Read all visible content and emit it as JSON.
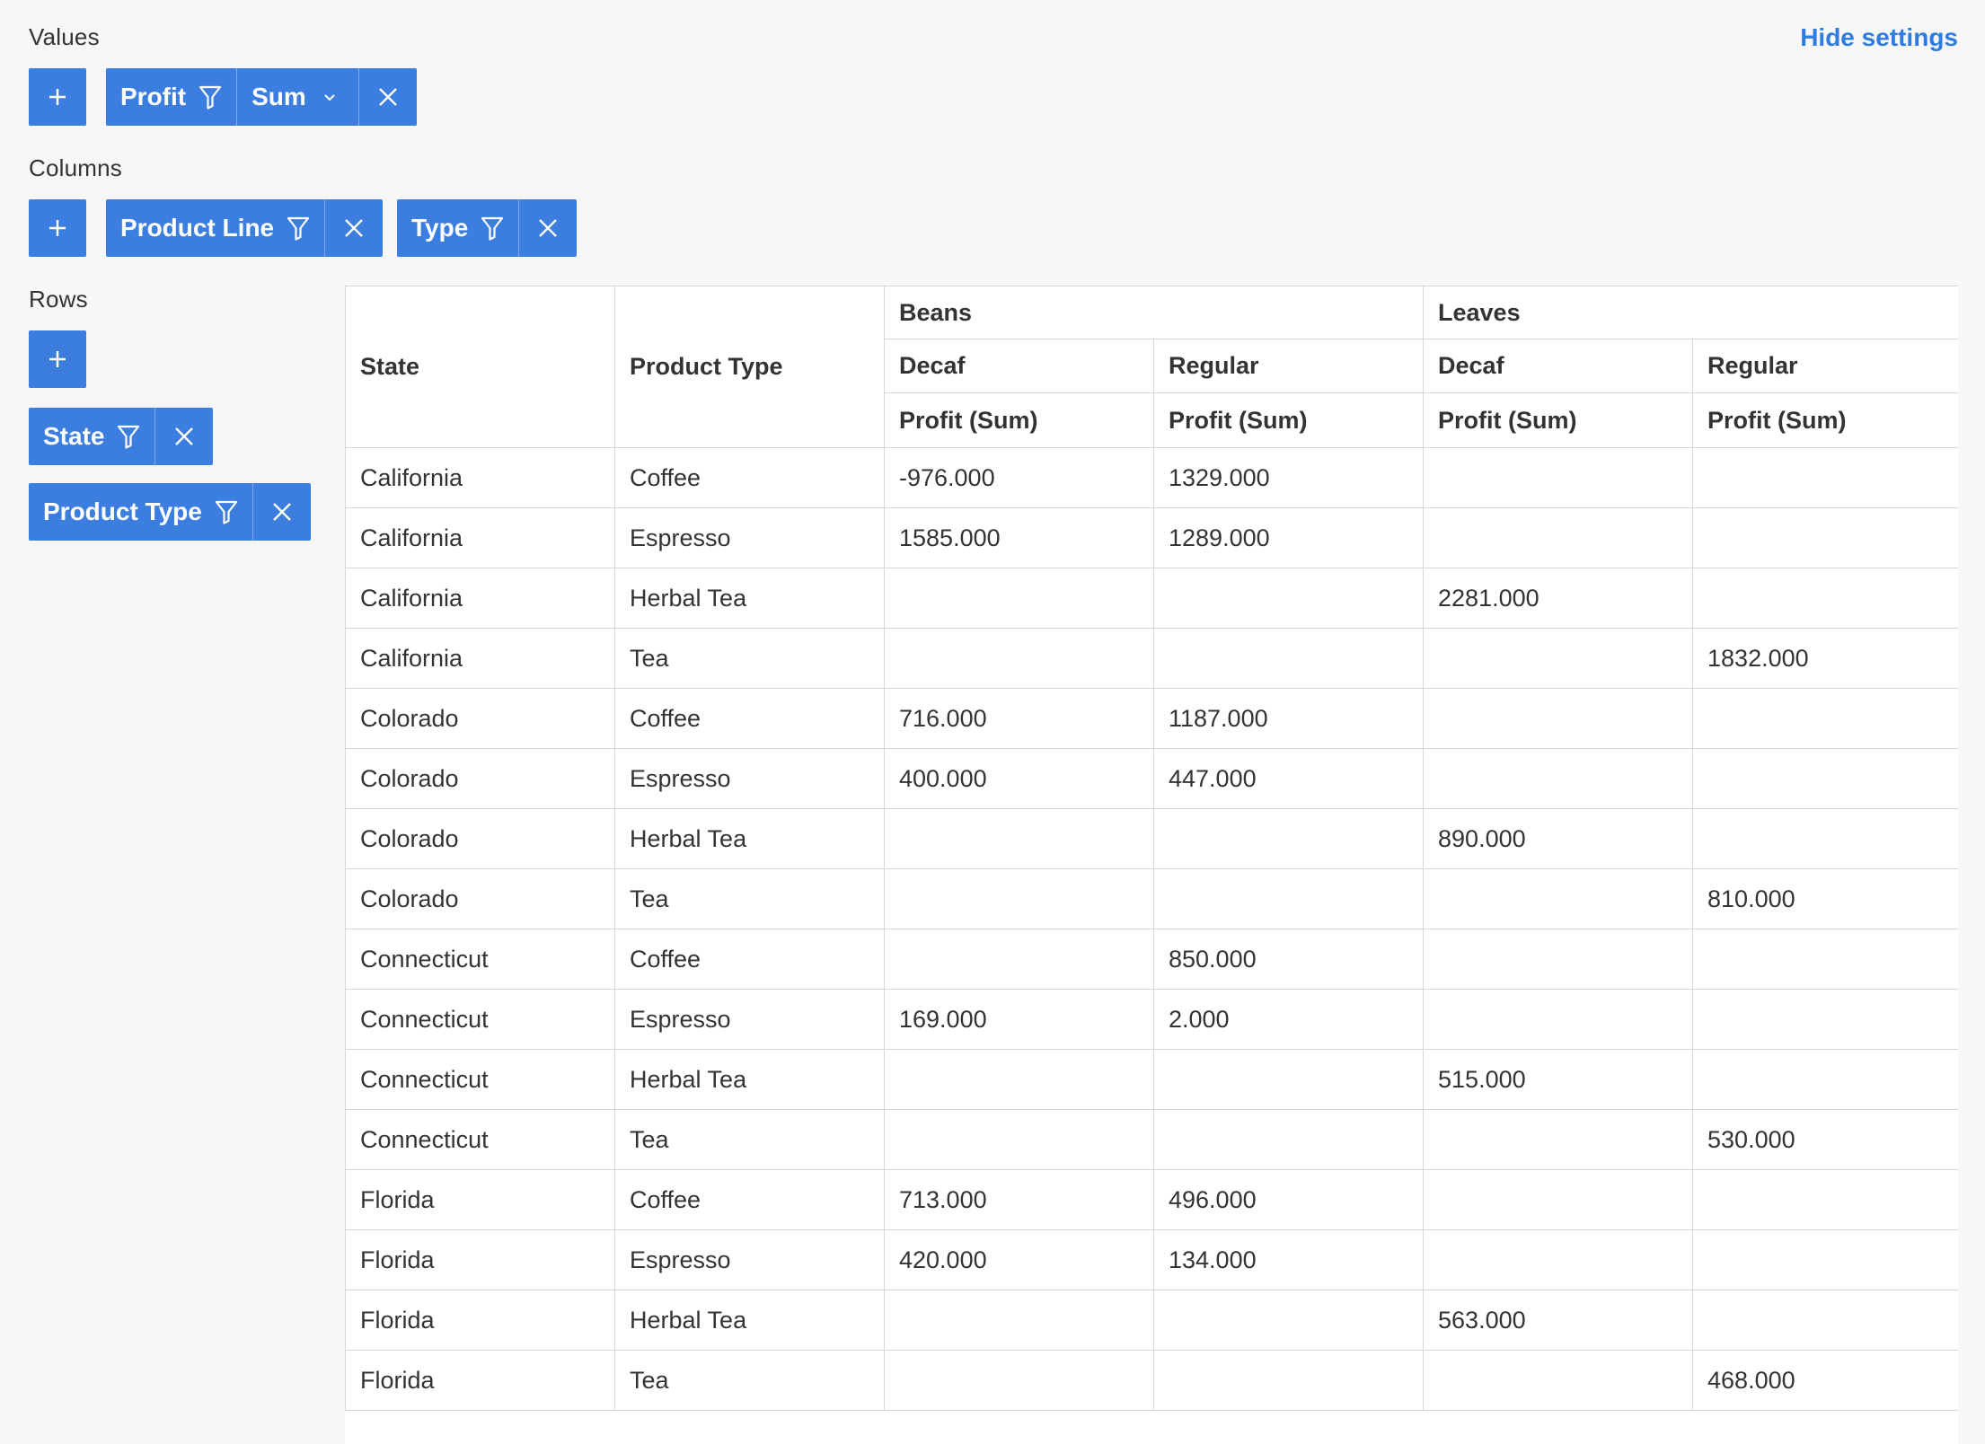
{
  "settings": {
    "hide_settings_label": "Hide settings",
    "values_label": "Values",
    "columns_label": "Columns",
    "rows_label": "Rows",
    "values_chips": [
      {
        "field": "Profit",
        "aggregation": "Sum"
      }
    ],
    "columns_chips": [
      {
        "field": "Product Line"
      },
      {
        "field": "Type"
      }
    ],
    "rows_chips": [
      {
        "field": "State"
      },
      {
        "field": "Product Type"
      }
    ],
    "accent_color": "#3b7ee0",
    "link_color": "#2f7ce0"
  },
  "table": {
    "row_headers": [
      "State",
      "Product Type"
    ],
    "column_groups": [
      {
        "label": "Beans",
        "types": [
          {
            "label": "Decaf",
            "measure": "Profit (Sum)"
          },
          {
            "label": "Regular",
            "measure": "Profit (Sum)"
          }
        ]
      },
      {
        "label": "Leaves",
        "types": [
          {
            "label": "Decaf",
            "measure": "Profit (Sum)"
          },
          {
            "label": "Regular",
            "measure": "Profit (Sum)"
          }
        ]
      }
    ],
    "rows": [
      [
        "California",
        "Coffee",
        "-976.000",
        "1329.000",
        "",
        ""
      ],
      [
        "California",
        "Espresso",
        "1585.000",
        "1289.000",
        "",
        ""
      ],
      [
        "California",
        "Herbal Tea",
        "",
        "",
        "2281.000",
        ""
      ],
      [
        "California",
        "Tea",
        "",
        "",
        "",
        "1832.000"
      ],
      [
        "Colorado",
        "Coffee",
        "716.000",
        "1187.000",
        "",
        ""
      ],
      [
        "Colorado",
        "Espresso",
        "400.000",
        "447.000",
        "",
        ""
      ],
      [
        "Colorado",
        "Herbal Tea",
        "",
        "",
        "890.000",
        ""
      ],
      [
        "Colorado",
        "Tea",
        "",
        "",
        "",
        "810.000"
      ],
      [
        "Connecticut",
        "Coffee",
        "",
        "850.000",
        "",
        ""
      ],
      [
        "Connecticut",
        "Espresso",
        "169.000",
        "2.000",
        "",
        ""
      ],
      [
        "Connecticut",
        "Herbal Tea",
        "",
        "",
        "515.000",
        ""
      ],
      [
        "Connecticut",
        "Tea",
        "",
        "",
        "",
        "530.000"
      ],
      [
        "Florida",
        "Coffee",
        "713.000",
        "496.000",
        "",
        ""
      ],
      [
        "Florida",
        "Espresso",
        "420.000",
        "134.000",
        "",
        ""
      ],
      [
        "Florida",
        "Herbal Tea",
        "",
        "",
        "563.000",
        ""
      ],
      [
        "Florida",
        "Tea",
        "",
        "",
        "",
        "468.000"
      ]
    ]
  }
}
